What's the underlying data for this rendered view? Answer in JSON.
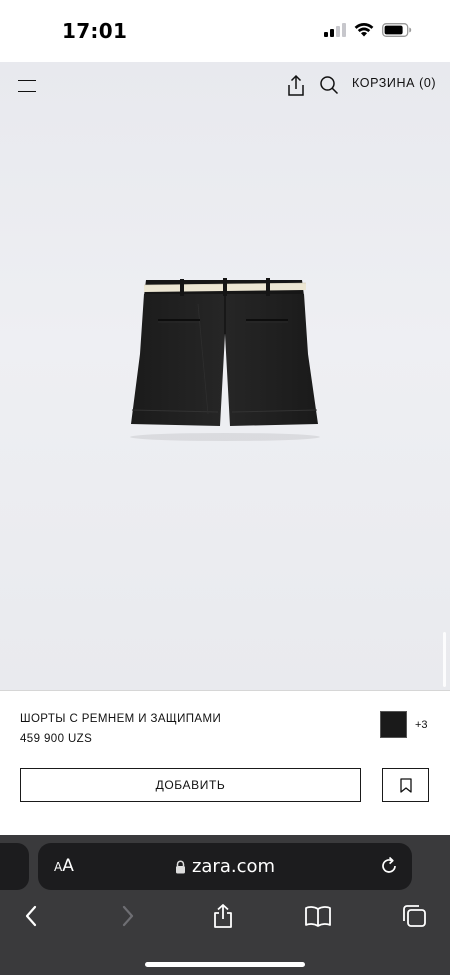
{
  "status_bar": {
    "time": "17:01",
    "icons": [
      "signal-icon",
      "wifi-icon",
      "battery-icon"
    ]
  },
  "nav": {
    "cart_label": "КОРЗИНА (0)",
    "icons": [
      "menu-icon",
      "share-icon",
      "search-icon"
    ]
  },
  "product": {
    "name": "ШОРТЫ С РЕМНЕМ И ЗАЩИПАМИ",
    "price": "459 900 UZS",
    "more_colors": "+3",
    "swatch_color": "#1a1a1a",
    "add_label": "ДОБАВИТЬ"
  },
  "browser": {
    "aa_small": "A",
    "aa_big": "A",
    "url": "zara.com",
    "toolbar_icons": [
      "back-icon",
      "forward-icon",
      "share-icon",
      "bookmarks-icon",
      "tabs-icon"
    ]
  },
  "colors": {
    "hero_background": "#eceef2",
    "safari_background": "#3a3a3c",
    "address_bar": "#1c1c1e"
  }
}
